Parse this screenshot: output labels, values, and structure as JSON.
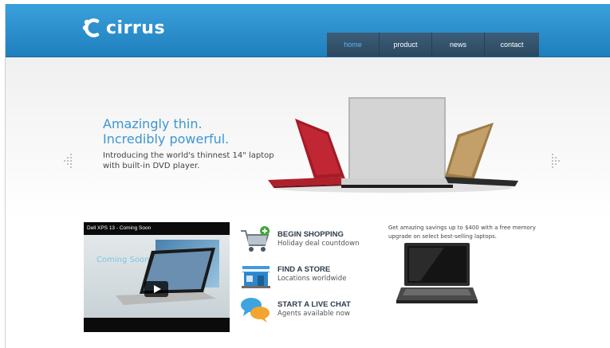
{
  "brand": {
    "name": "cirrus"
  },
  "nav": {
    "items": [
      {
        "label": "home",
        "active": true
      },
      {
        "label": "product",
        "active": false
      },
      {
        "label": "news",
        "active": false
      },
      {
        "label": "contact",
        "active": false
      }
    ]
  },
  "hero": {
    "headline_line1": "Amazingly thin.",
    "headline_line2": "Incredibly powerful.",
    "description_line1": "Introducing the world's thinnest 14\" laptop",
    "description_line2": "with built-in DVD player."
  },
  "video": {
    "title": "Dell XPS 13 - Coming Soon",
    "overlay_text": "Coming Soon"
  },
  "features": [
    {
      "title": "BEGIN SHOPPING",
      "subtitle": "Holiday deal countdown",
      "icon": "shopping-cart-icon"
    },
    {
      "title": "FIND A STORE",
      "subtitle": "Locations worldwide",
      "icon": "store-icon"
    },
    {
      "title": "START A LIVE CHAT",
      "subtitle": "Agents available now",
      "icon": "chat-bubbles-icon"
    }
  ],
  "promo": {
    "text_line1": "Get amazing savings up to $400 with a free memory",
    "text_line2": "upgrade on select best-selling laptops."
  },
  "colors": {
    "header_blue": "#2a8fcf",
    "nav_dark": "#34516a",
    "nav_active_text": "#5ab6f0",
    "headline_blue": "#3d96d4",
    "laptop_red": "#b0202c",
    "laptop_silver": "#c9c9c9",
    "laptop_gold": "#b8955c"
  }
}
